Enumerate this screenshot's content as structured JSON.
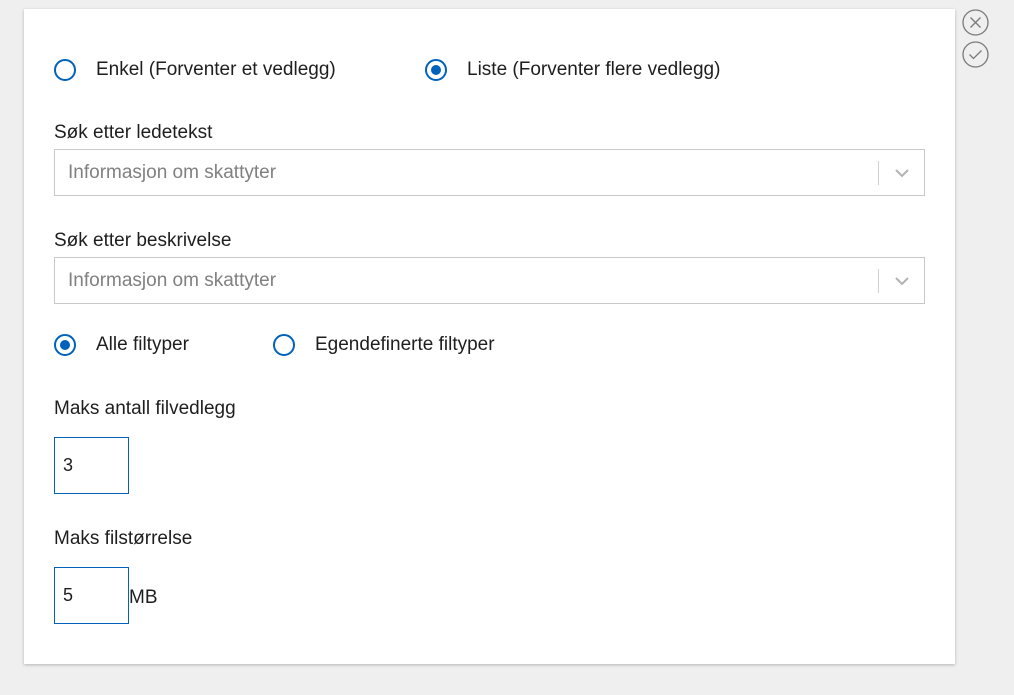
{
  "attachment_type": {
    "options": [
      {
        "label": "Enkel (Forventer et vedlegg)",
        "checked": false
      },
      {
        "label": "Liste (Forventer flere vedlegg)",
        "checked": true
      }
    ]
  },
  "search_prompt": {
    "label": "Søk etter ledetekst",
    "value": "Informasjon om skattyter"
  },
  "search_description": {
    "label": "Søk etter beskrivelse",
    "value": "Informasjon om skattyter"
  },
  "file_types": {
    "options": [
      {
        "label": "Alle filtyper",
        "checked": true
      },
      {
        "label": "Egendefinerte filtyper",
        "checked": false
      }
    ]
  },
  "max_attachments": {
    "label": "Maks antall filvedlegg",
    "value": "3"
  },
  "max_file_size": {
    "label": "Maks filstørrelse",
    "value": "5",
    "unit": "MB"
  },
  "colors": {
    "accent": "#0062ba",
    "border": "#c9c9c9",
    "placeholder": "#808080",
    "background": "#efefef"
  },
  "icons": {
    "close": "close-circle-icon",
    "confirm": "check-circle-icon",
    "dropdown": "chevron-down-icon"
  }
}
